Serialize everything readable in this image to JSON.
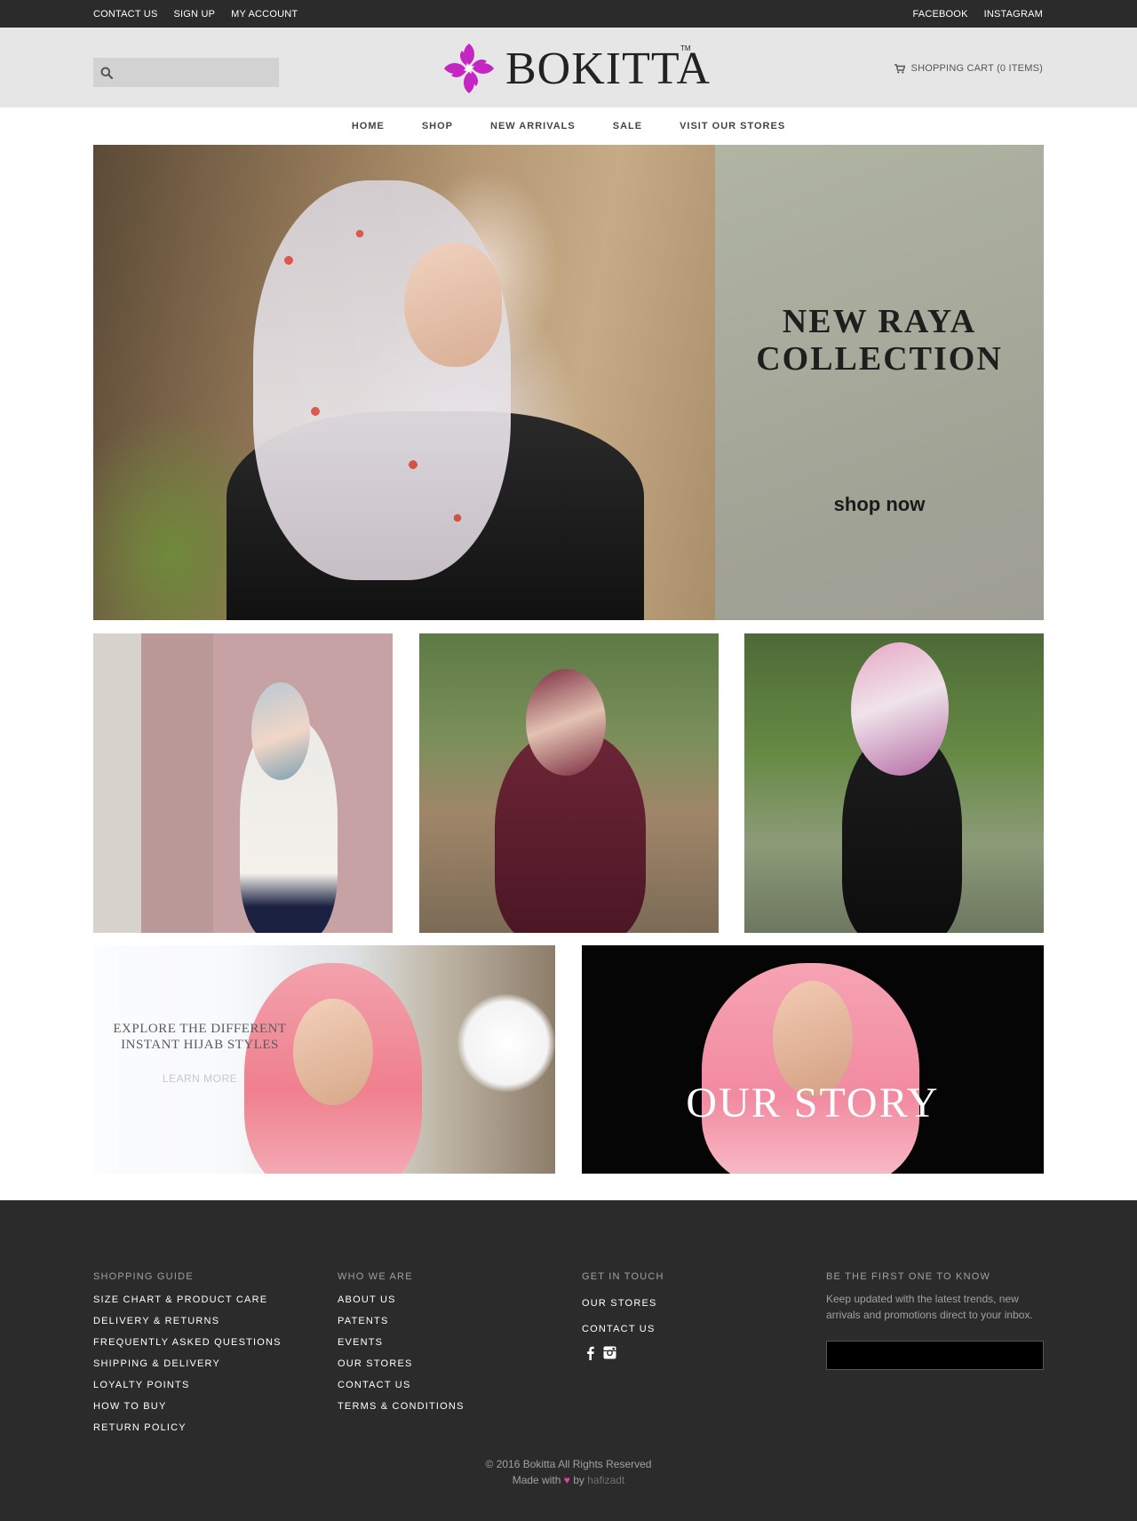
{
  "topbar": {
    "left_links": [
      "CONTACT US",
      "SIGN UP",
      "MY ACCOUNT"
    ],
    "right_links": [
      "FACEBOOK",
      "INSTAGRAM"
    ]
  },
  "header": {
    "search_placeholder": "",
    "logo_text": "BOKITTA",
    "logo_tm": "TM",
    "cart_label": "SHOPPING CART (0 ITEMS)"
  },
  "nav": {
    "items": [
      "HOME",
      "SHOP",
      "NEW ARRIVALS",
      "SALE",
      "VISIT OUR STORES"
    ]
  },
  "hero": {
    "title_line1": "NEW RAYA",
    "title_line2": "COLLECTION",
    "cta": "shop now"
  },
  "promos": {
    "left_heading_line1": "EXPLORE THE DIFFERENT",
    "left_heading_line2": "INSTANT HIJAB STYLES",
    "left_cta": "LEARN MORE",
    "right_heading": "OUR STORY"
  },
  "footer": {
    "shopping_guide": {
      "title": "SHOPPING GUIDE",
      "links": [
        "SIZE CHART & PRODUCT CARE",
        "DELIVERY & RETURNS",
        "FREQUENTLY ASKED QUESTIONS",
        "SHIPPING & DELIVERY",
        "LOYALTY POINTS",
        "HOW TO BUY",
        "RETURN POLICY"
      ]
    },
    "who_we_are": {
      "title": "WHO WE ARE",
      "links": [
        "ABOUT US",
        "PATENTS",
        "EVENTS",
        "OUR STORES",
        "CONTACT US",
        "TERMS & CONDITIONS"
      ]
    },
    "get_in_touch": {
      "title": "GET IN TOUCH",
      "links": [
        "OUR STORES",
        "CONTACT US"
      ]
    },
    "newsletter": {
      "title": "BE THE FIRST ONE TO KNOW",
      "text": "Keep updated with the latest trends, new arrivals and promotions direct to your inbox.",
      "placeholder": ""
    },
    "copyright": "© 2016 Bokitta All Rights Reserved",
    "made_with": "Made with",
    "heart": "♥",
    "by": "by",
    "author": "hafizadt"
  },
  "colors": {
    "topbar_bg": "#2b2b2b",
    "header_bg": "#e6e6e6",
    "footer_bg": "#2b2b2b",
    "logo_magenta": "#c426c2",
    "heart_pink": "#e63f9a"
  },
  "icons": {
    "search": "search-icon",
    "cart": "cart-icon",
    "facebook": "facebook-icon",
    "instagram": "instagram-icon",
    "logo_mark": "flower-logo-icon"
  }
}
